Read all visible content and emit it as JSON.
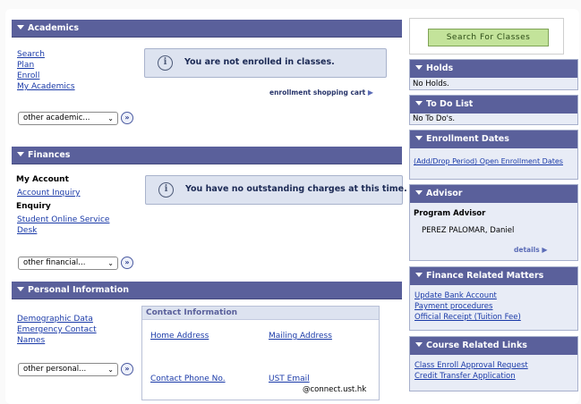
{
  "academics": {
    "title": "Academics",
    "links": [
      "Search",
      "Plan",
      "Enroll",
      "My Academics"
    ],
    "message": "You are not enrolled in classes.",
    "cart_link": "enrollment shopping cart",
    "select_value": "other academic..."
  },
  "finances": {
    "title": "Finances",
    "my_account": "My Account",
    "account_inquiry": "Account Inquiry",
    "enquiry": "Enquiry",
    "student_online_service_1": "Student Online Service",
    "student_online_service_2": "Desk",
    "message": "You have no outstanding charges at this time.",
    "select_value": "other financial..."
  },
  "personal": {
    "title": "Personal Information",
    "links": [
      "Demographic Data",
      "Emergency Contact",
      "Names"
    ],
    "select_value": "other personal...",
    "contact": {
      "title": "Contact Information",
      "home_address": "Home Address",
      "mailing_address": "Mailing Address",
      "contact_phone": "Contact Phone No.",
      "ust_email": "UST Email",
      "email_domain": "@connect.ust.hk"
    }
  },
  "sidebar": {
    "search_button": "Search For Classes",
    "holds": {
      "title": "Holds",
      "text": "No Holds."
    },
    "todo": {
      "title": "To Do List",
      "text": "No To Do's."
    },
    "enrollment_dates": {
      "title": "Enrollment Dates",
      "link": "(Add/Drop Period) Open Enrollment Dates"
    },
    "advisor": {
      "title": "Advisor",
      "label": "Program Advisor",
      "name": "PEREZ PALOMAR, Daniel",
      "details": "details"
    },
    "finance_related": {
      "title": "Finance Related Matters",
      "links": [
        "Update Bank Account",
        "Payment procedures",
        "Official Receipt (Tuition Fee)"
      ]
    },
    "course_related": {
      "title": "Course Related Links",
      "links": [
        "Class Enroll Approval Request",
        "Credit Transfer Application"
      ]
    }
  },
  "icons": {
    "go": "double-chevron-right-icon",
    "info": "info-circle-icon",
    "collapse": "collapse-triangle-icon"
  },
  "colors": {
    "header": "#5a609b",
    "link": "#1a3aa8",
    "message_bg": "#dde3f0",
    "search_button": "#c3e39a"
  }
}
